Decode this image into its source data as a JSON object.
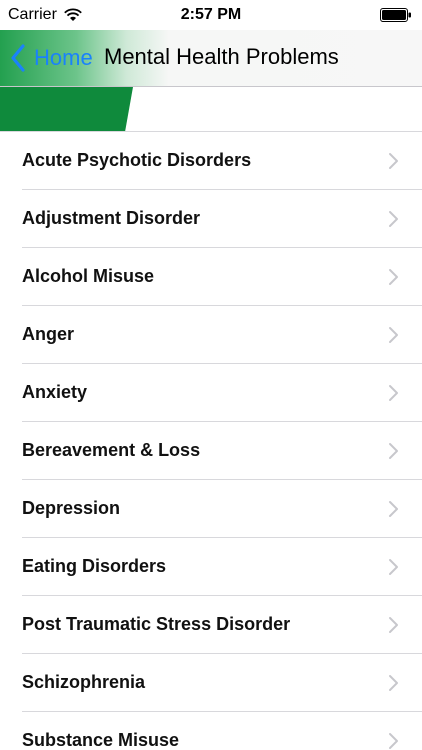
{
  "status_bar": {
    "carrier": "Carrier",
    "time": "2:57 PM",
    "wifi_icon": "wifi-icon",
    "battery_icon": "battery-icon"
  },
  "nav": {
    "back_label": "Home",
    "title": "Mental Health Problems"
  },
  "colors": {
    "accent_green": "#0f8a3c",
    "link_blue": "#1a82fb"
  },
  "list": {
    "items": [
      {
        "label": "Acute Psychotic Disorders"
      },
      {
        "label": "Adjustment Disorder"
      },
      {
        "label": "Alcohol Misuse"
      },
      {
        "label": "Anger"
      },
      {
        "label": "Anxiety"
      },
      {
        "label": "Bereavement & Loss"
      },
      {
        "label": "Depression"
      },
      {
        "label": "Eating Disorders"
      },
      {
        "label": "Post Traumatic Stress Disorder"
      },
      {
        "label": "Schizophrenia"
      },
      {
        "label": "Substance Misuse"
      }
    ]
  }
}
